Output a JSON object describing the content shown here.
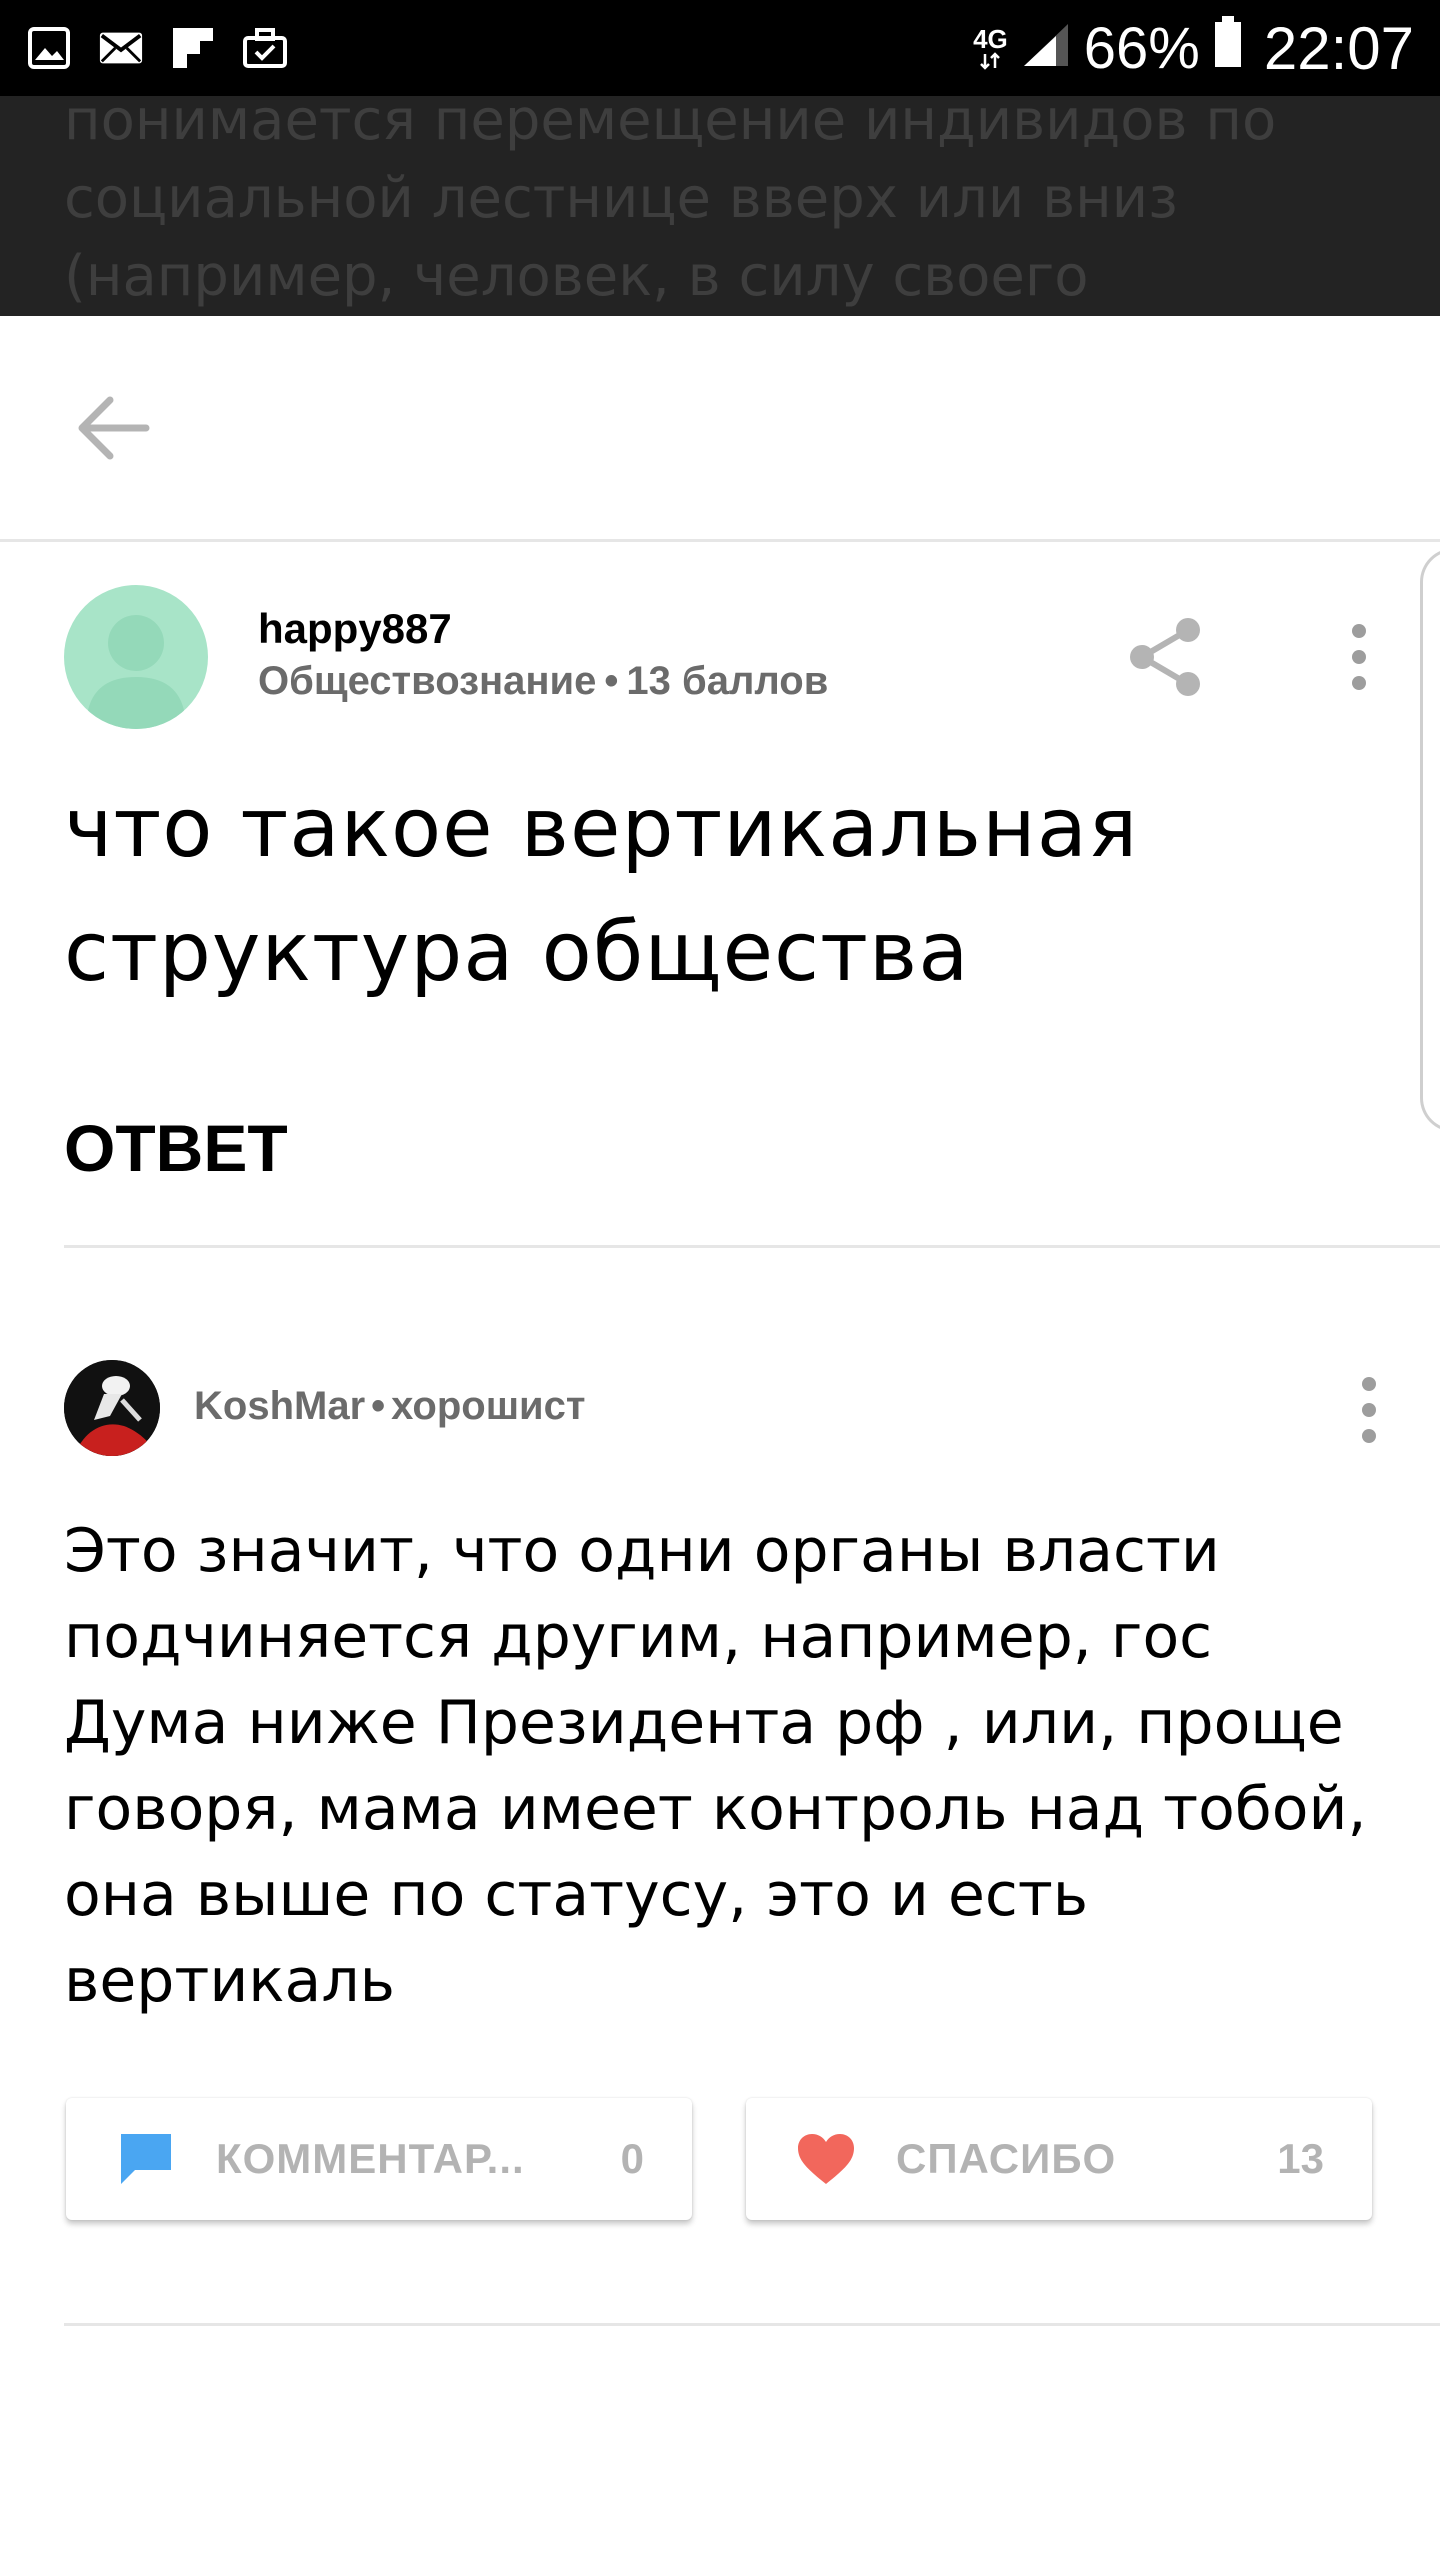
{
  "status_bar": {
    "left_icons": [
      "gallery-icon",
      "mail-icon",
      "flipboard-icon",
      "briefcase-icon"
    ],
    "network_type": "4G",
    "battery_percent": "66%",
    "time": "22:07"
  },
  "overlay": {
    "lines": [
      "понимается перемещение индивидов по",
      "социальной лестнице вверх или вниз",
      "(например, человек, в силу своего"
    ]
  },
  "app_bar": {
    "back_icon": "arrow-left-icon"
  },
  "question": {
    "author": "happy887",
    "subject": "Обществознание",
    "separator": "•",
    "points": "13 баллов",
    "title": "что такое вертикальная структура общества",
    "avatar_color": "#a8e4c8"
  },
  "answer_section": {
    "heading": "ОТВЕТ"
  },
  "answer": {
    "author": "KoshMar",
    "separator": "•",
    "rank": "хорошист",
    "text": "Это значит, что одни органы власти подчиняется другим, например, гос Дума ниже Президента рф , или, проще говоря, мама имеет контроль над тобой, она выше по статусу, это и есть вертикаль",
    "comments_label": "КОММЕНТАР...",
    "comments_count": "0",
    "thanks_label": "СПАСИБО",
    "thanks_count": "13",
    "comment_icon_color": "#4aa6f2",
    "heart_icon_color": "#f2675c"
  }
}
